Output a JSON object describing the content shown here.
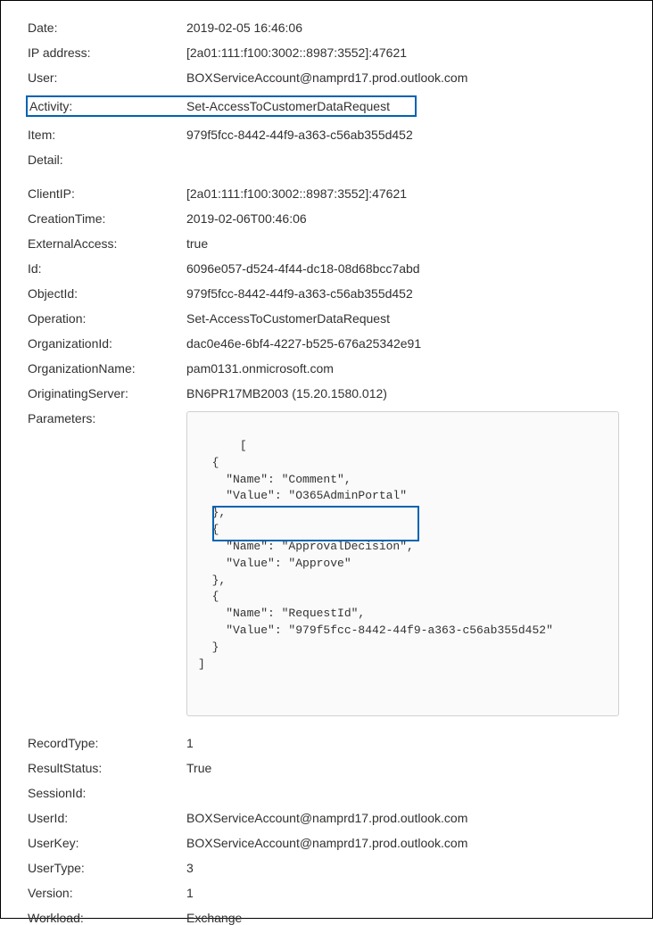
{
  "basic": {
    "date_label": "Date:",
    "date_value": "2019-02-05 16:46:06",
    "ip_label": "IP address:",
    "ip_value": "[2a01:111:f100:3002::8987:3552]:47621",
    "user_label": "User:",
    "user_value": "BOXServiceAccount@namprd17.prod.outlook.com",
    "activity_label": "Activity:",
    "activity_value": "Set-AccessToCustomerDataRequest",
    "item_label": "Item:",
    "item_value": "979f5fcc-8442-44f9-a363-c56ab355d452",
    "detail_label": "Detail:"
  },
  "detail": {
    "clientip_label": "ClientIP:",
    "clientip_value": "[2a01:111:f100:3002::8987:3552]:47621",
    "creationtime_label": "CreationTime:",
    "creationtime_value": "2019-02-06T00:46:06",
    "externalaccess_label": "ExternalAccess:",
    "externalaccess_value": "true",
    "id_label": "Id:",
    "id_value": "6096e057-d524-4f44-dc18-08d68bcc7abd",
    "objectid_label": "ObjectId:",
    "objectid_value": "979f5fcc-8442-44f9-a363-c56ab355d452",
    "operation_label": "Operation:",
    "operation_value": "Set-AccessToCustomerDataRequest",
    "organizationid_label": "OrganizationId:",
    "organizationid_value": "dac0e46e-6bf4-4227-b525-676a25342e91",
    "organizationname_label": "OrganizationName:",
    "organizationname_value": "pam0131.onmicrosoft.com",
    "originatingserver_label": "OriginatingServer:",
    "originatingserver_value": "BN6PR17MB2003 (15.20.1580.012)",
    "parameters_label": "Parameters:",
    "parameters_value": "[\n  {\n    \"Name\": \"Comment\",\n    \"Value\": \"O365AdminPortal\"\n  },\n  {\n    \"Name\": \"ApprovalDecision\",\n    \"Value\": \"Approve\"\n  },\n  {\n    \"Name\": \"RequestId\",\n    \"Value\": \"979f5fcc-8442-44f9-a363-c56ab355d452\"\n  }\n]",
    "recordtype_label": "RecordType:",
    "recordtype_value": "1",
    "resultstatus_label": "ResultStatus:",
    "resultstatus_value": "True",
    "sessionid_label": "SessionId:",
    "sessionid_value": "",
    "userid_label": "UserId:",
    "userid_value": "BOXServiceAccount@namprd17.prod.outlook.com",
    "userkey_label": "UserKey:",
    "userkey_value": "BOXServiceAccount@namprd17.prod.outlook.com",
    "usertype_label": "UserType:",
    "usertype_value": "3",
    "version_label": "Version:",
    "version_value": "1",
    "workload_label": "Workload:",
    "workload_value": "Exchange"
  }
}
